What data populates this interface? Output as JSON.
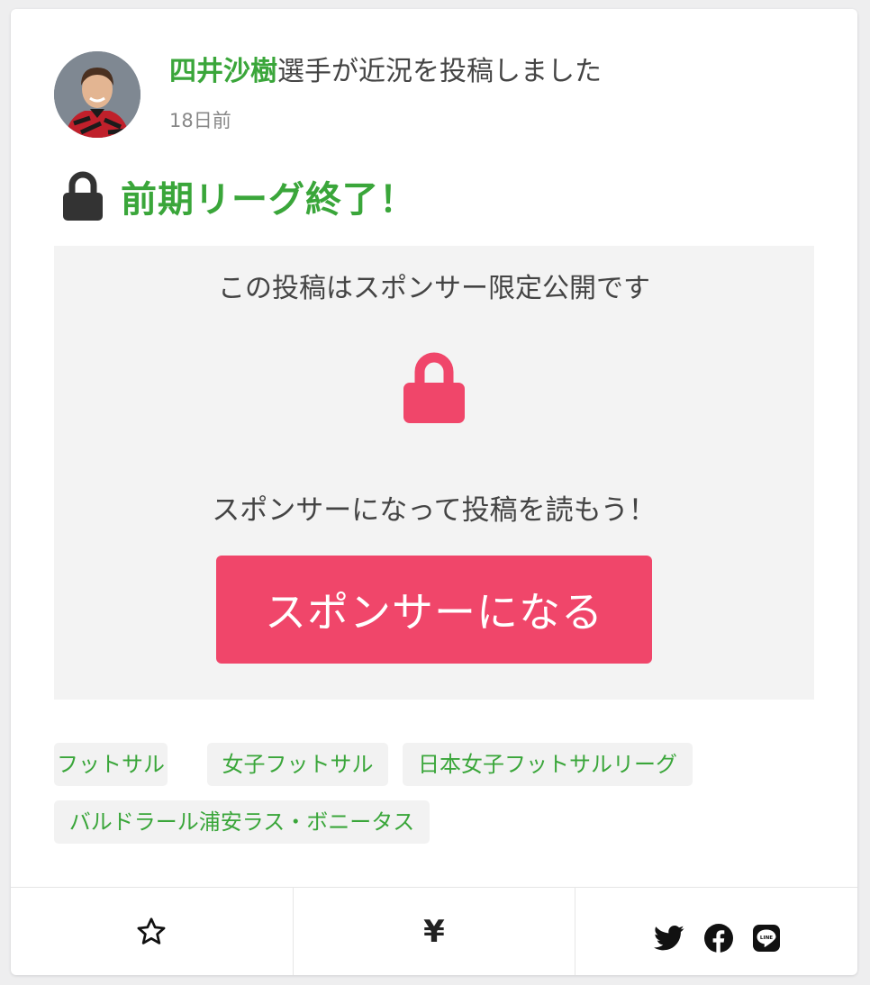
{
  "post": {
    "athlete_name": "四井沙樹",
    "headline_suffix": "選手が近況を投稿しました",
    "timestamp": "18日前",
    "title": "前期リーグ終了！"
  },
  "locked": {
    "notice": "この投稿はスポンサー限定公開です",
    "cta_text": "スポンサーになって投稿を読もう！",
    "button_label": "スポンサーになる"
  },
  "tags": [
    "フットサル",
    "女子フットサル",
    "日本女子フットサルリーグ",
    "バルドラール浦安ラス・ボニータス"
  ],
  "actions": {
    "favorite_icon": "star-outline-icon",
    "tip_symbol": "¥",
    "share_icons": [
      "twitter-icon",
      "facebook-icon",
      "line-icon"
    ]
  },
  "colors": {
    "accent_green": "#3aa63a",
    "sponsor_pink": "#f0466a",
    "locked_bg": "#f3f3f3"
  }
}
